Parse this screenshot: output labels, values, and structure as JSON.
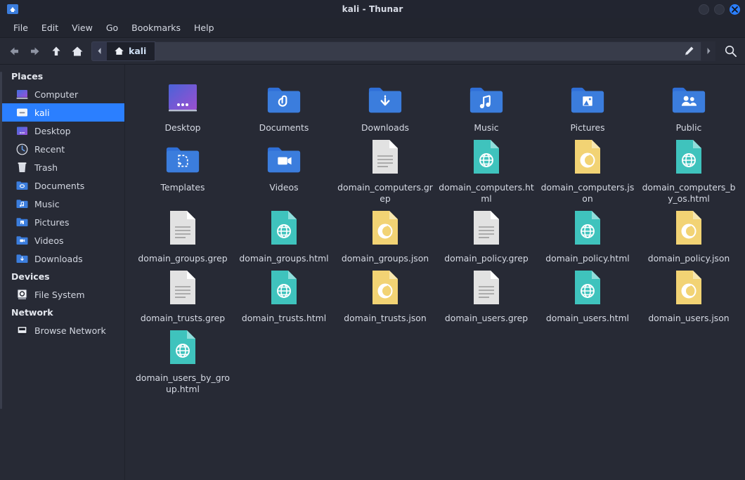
{
  "window": {
    "title": "kali - Thunar",
    "app_icon": "home-folder-icon",
    "controls": [
      {
        "name": "minimize-button",
        "glyph": ""
      },
      {
        "name": "maximize-button",
        "glyph": ""
      },
      {
        "name": "close-button",
        "glyph": "✕"
      }
    ],
    "close_color": "#2b7fff"
  },
  "menubar": {
    "items": [
      {
        "label": "File"
      },
      {
        "label": "Edit"
      },
      {
        "label": "View"
      },
      {
        "label": "Go"
      },
      {
        "label": "Bookmarks"
      },
      {
        "label": "Help"
      }
    ]
  },
  "toolbar": {
    "buttons": [
      {
        "name": "back-button",
        "icon": "arrow-left-icon"
      },
      {
        "name": "forward-button",
        "icon": "arrow-right-icon"
      },
      {
        "name": "up-button",
        "icon": "arrow-up-icon"
      },
      {
        "name": "home-button",
        "icon": "home-icon"
      }
    ],
    "breadcrumb_prev_icon": "chevron-left-icon",
    "breadcrumb_current": "kali",
    "breadcrumb_current_icon": "home-icon",
    "path_value": "",
    "path_placeholder": "",
    "edit_icon": "pencil-icon",
    "dropdown_icon": "chevron-right-icon",
    "search_icon": "search-icon"
  },
  "sidebar": {
    "sections": [
      {
        "heading": "Places",
        "items": [
          {
            "label": "Computer",
            "icon": "computer-icon",
            "selected": false
          },
          {
            "label": "kali",
            "icon": "home-folder-icon",
            "selected": true
          },
          {
            "label": "Desktop",
            "icon": "desktop-icon",
            "selected": false
          },
          {
            "label": "Recent",
            "icon": "clock-icon",
            "selected": false
          },
          {
            "label": "Trash",
            "icon": "trash-icon",
            "selected": false
          },
          {
            "label": "Documents",
            "icon": "documents-folder-icon",
            "selected": false
          },
          {
            "label": "Music",
            "icon": "music-folder-icon",
            "selected": false
          },
          {
            "label": "Pictures",
            "icon": "pictures-folder-icon",
            "selected": false
          },
          {
            "label": "Videos",
            "icon": "videos-folder-icon",
            "selected": false
          },
          {
            "label": "Downloads",
            "icon": "downloads-folder-icon",
            "selected": false
          }
        ]
      },
      {
        "heading": "Devices",
        "items": [
          {
            "label": "File System",
            "icon": "harddisk-icon",
            "selected": false
          }
        ]
      },
      {
        "heading": "Network",
        "items": [
          {
            "label": "Browse Network",
            "icon": "network-icon",
            "selected": false
          }
        ]
      }
    ]
  },
  "files": [
    {
      "name": "Desktop",
      "icon": "desktop-folder-icon",
      "type": "folder"
    },
    {
      "name": "Documents",
      "icon": "documents-folder-icon",
      "type": "folder"
    },
    {
      "name": "Downloads",
      "icon": "downloads-folder-icon",
      "type": "folder"
    },
    {
      "name": "Music",
      "icon": "music-folder-icon",
      "type": "folder"
    },
    {
      "name": "Pictures",
      "icon": "pictures-folder-icon",
      "type": "folder"
    },
    {
      "name": "Public",
      "icon": "public-folder-icon",
      "type": "folder"
    },
    {
      "name": "Templates",
      "icon": "templates-folder-icon",
      "type": "folder"
    },
    {
      "name": "Videos",
      "icon": "videos-folder-icon",
      "type": "folder"
    },
    {
      "name": "domain_computers.grep",
      "icon": "text-file-icon",
      "type": "grep"
    },
    {
      "name": "domain_computers.html",
      "icon": "html-file-icon",
      "type": "html"
    },
    {
      "name": "domain_computers.json",
      "icon": "json-file-icon",
      "type": "json"
    },
    {
      "name": "domain_computers_by_os.html",
      "icon": "html-file-icon",
      "type": "html"
    },
    {
      "name": "domain_groups.grep",
      "icon": "text-file-icon",
      "type": "grep"
    },
    {
      "name": "domain_groups.html",
      "icon": "html-file-icon",
      "type": "html"
    },
    {
      "name": "domain_groups.json",
      "icon": "json-file-icon",
      "type": "json"
    },
    {
      "name": "domain_policy.grep",
      "icon": "text-file-icon",
      "type": "grep"
    },
    {
      "name": "domain_policy.html",
      "icon": "html-file-icon",
      "type": "html"
    },
    {
      "name": "domain_policy.json",
      "icon": "json-file-icon",
      "type": "json"
    },
    {
      "name": "domain_trusts.grep",
      "icon": "text-file-icon",
      "type": "grep"
    },
    {
      "name": "domain_trusts.html",
      "icon": "html-file-icon",
      "type": "html"
    },
    {
      "name": "domain_trusts.json",
      "icon": "json-file-icon",
      "type": "json"
    },
    {
      "name": "domain_users.grep",
      "icon": "text-file-icon",
      "type": "grep"
    },
    {
      "name": "domain_users.html",
      "icon": "html-file-icon",
      "type": "html"
    },
    {
      "name": "domain_users.json",
      "icon": "json-file-icon",
      "type": "json"
    },
    {
      "name": "domain_users_by_group.html",
      "icon": "html-file-icon",
      "type": "html"
    }
  ],
  "colors": {
    "background": "#272a35",
    "accent": "#2b7fff",
    "folder": "#3b7ddd",
    "html_file": "#3fc3bd",
    "json_file": "#f2d374",
    "text_file": "#e2e2e2"
  }
}
